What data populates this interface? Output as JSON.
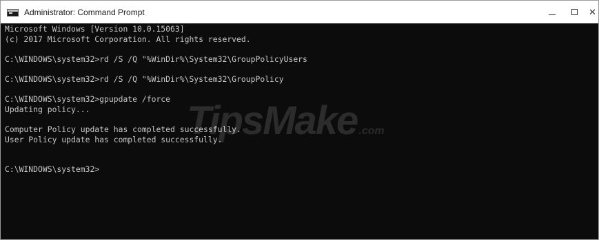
{
  "window": {
    "title": "Administrator: Command Prompt",
    "app_icon": "cmd-console-icon",
    "controls": {
      "minimize_icon": "minimize-icon",
      "maximize_icon": "maximize-icon",
      "close_icon": "close-icon",
      "close_glyph": "✕"
    }
  },
  "console": {
    "background": "#0c0c0c",
    "foreground": "#c8c8c8",
    "lines": [
      "Microsoft Windows [Version 10.0.15063]",
      "(c) 2017 Microsoft Corporation. All rights reserved.",
      "",
      "C:\\WINDOWS\\system32>rd /S /Q \"%WinDir%\\System32\\GroupPolicyUsers",
      "",
      "C:\\WINDOWS\\system32>rd /S /Q \"%WinDir%\\System32\\GroupPolicy",
      "",
      "C:\\WINDOWS\\system32>gpupdate /force",
      "Updating policy...",
      "",
      "Computer Policy update has completed successfully.",
      "User Policy update has completed successfully.",
      "",
      "",
      "C:\\WINDOWS\\system32>"
    ]
  },
  "watermark": {
    "main": "TipsMake",
    "suffix": ".com"
  }
}
